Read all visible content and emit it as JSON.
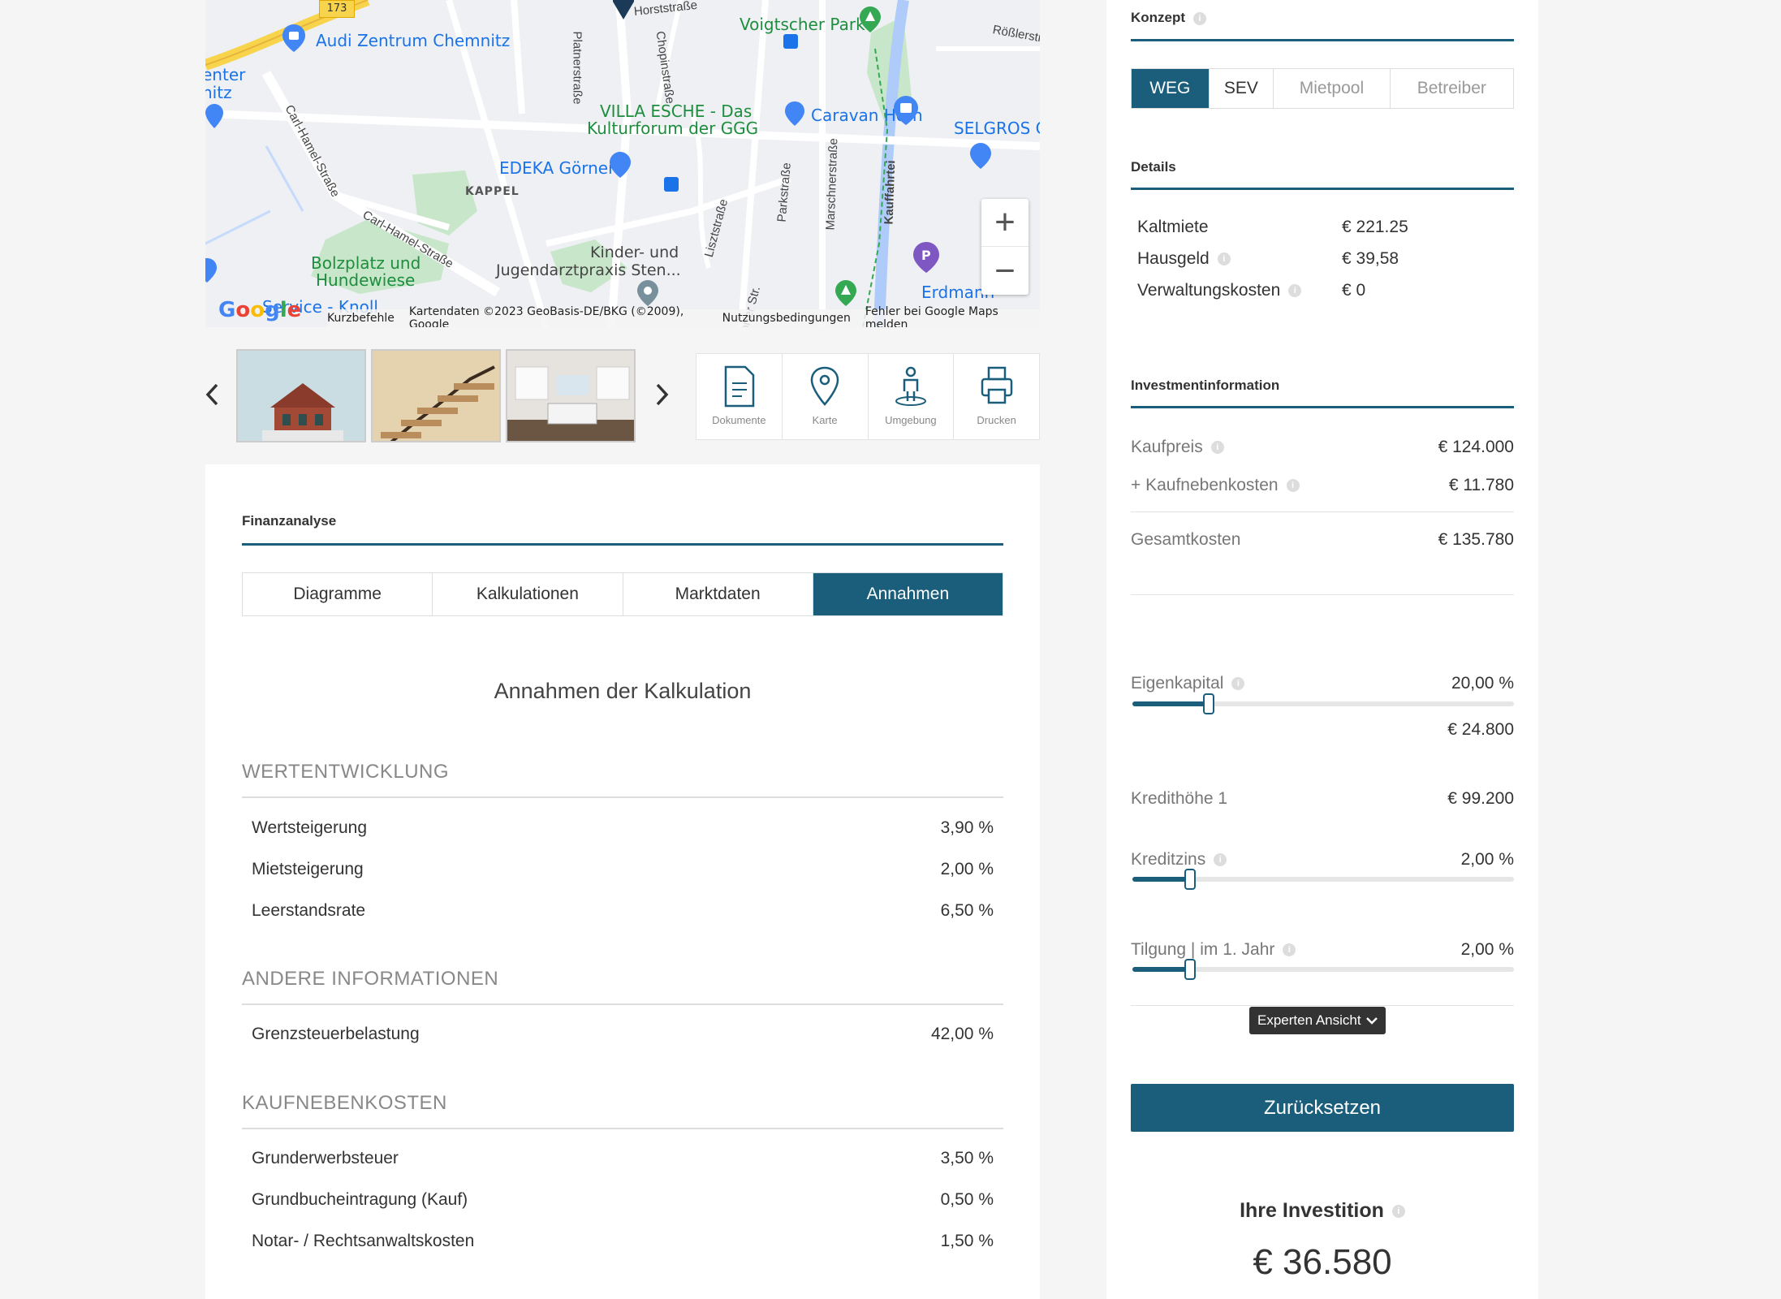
{
  "map": {
    "labels": {
      "audi": "Audi Zentrum Chemnitz",
      "voigtscher": "Voigtscher Park",
      "horststrasse": "Horststraße",
      "rosslerstrasse": "Rößlerstraße",
      "villa": "VILLA ESCHE - Das",
      "kulturforum": "Kulturforum der GGG",
      "caravan": "Caravan Horn",
      "selgros": "SELGROS C",
      "edeka": "EDEKA Görner",
      "kappel": "KAPPEL",
      "bolzplatz1": "Bolzplatz und",
      "bolzplatz2": "Hundewiese",
      "kinder1": "Kinder- und",
      "kinder2": "Jugendarztpraxis Sten...",
      "erdmann": "Erdmann",
      "service": "Service - Knoll",
      "center": "enter",
      "nitz": "nitz",
      "road173": "173",
      "carlhamel1": "Carl-Hamel-Straße",
      "carlhamel2": "Carl-Hamel-Straße",
      "platnerstrasse": "Platnerstraße",
      "chopinstrasse": "Chopinstraße",
      "lisztstrasse": "Lisztstraße",
      "parkstrasse": "Parkstraße",
      "marschnerstrasse": "Marschnerstraße",
      "kauffahrtei": "Kauffahrtei",
      "dorferstr": "orfer Str."
    },
    "zoom_in": "+",
    "zoom_out": "−",
    "footer": {
      "shortcuts": "Kurzbefehle",
      "mapdata": "Kartendaten ©2023 GeoBasis-DE/BKG (©2009), Google",
      "terms": "Nutzungsbedingungen",
      "report": "Fehler bei Google Maps melden"
    },
    "logo": "Google"
  },
  "gallery": {
    "prev": "‹",
    "next": "›",
    "tools": [
      {
        "label": "Dokumente",
        "icon": "document-icon"
      },
      {
        "label": "Karte",
        "icon": "map-pin-icon"
      },
      {
        "label": "Umgebung",
        "icon": "person-location-icon"
      },
      {
        "label": "Drucken",
        "icon": "printer-icon"
      }
    ]
  },
  "finanz": {
    "title": "Finanzanalyse",
    "tabs": [
      "Diagramme",
      "Kalkulationen",
      "Marktdaten",
      "Annahmen"
    ],
    "active_tab": "Annahmen",
    "heading": "Annahmen der Kalkulation",
    "groups": [
      {
        "title": "WERTENTWICKLUNG",
        "rows": [
          {
            "label": "Wertsteigerung",
            "value": "3,90 %"
          },
          {
            "label": "Mietsteigerung",
            "value": "2,00 %"
          },
          {
            "label": "Leerstandsrate",
            "value": "6,50 %"
          }
        ]
      },
      {
        "title": "ANDERE INFORMATIONEN",
        "rows": [
          {
            "label": "Grenzsteuerbelastung",
            "value": "42,00 %"
          }
        ]
      },
      {
        "title": "KAUFNEBENKOSTEN",
        "rows": [
          {
            "label": "Grunderwerbsteuer",
            "value": "3,50 %"
          },
          {
            "label": "Grundbucheintragung (Kauf)",
            "value": "0,50 %"
          },
          {
            "label": "Notar- / Rechtsanwaltskosten",
            "value": "1,50 %"
          }
        ]
      }
    ]
  },
  "sidebar": {
    "konzept_title": "Konzept",
    "konzept_options": [
      "WEG",
      "SEV",
      "Mietpool",
      "Betreiber"
    ],
    "konzept_active": "WEG",
    "details_title": "Details",
    "details": [
      {
        "label": "Kaltmiete",
        "value": "€ 221.25",
        "info": false
      },
      {
        "label": "Hausgeld",
        "value": "€ 39,58",
        "info": true
      },
      {
        "label": "Verwaltungskosten",
        "value": "€ 0",
        "info": true
      }
    ],
    "invest_title": "Investmentinformation",
    "kaufpreis": {
      "label": "Kaufpreis",
      "value": "€ 124.000"
    },
    "kaufnebenkosten": {
      "label": "+ Kaufnebenkosten",
      "value": "€ 11.780"
    },
    "gesamtkosten": {
      "label": "Gesamtkosten",
      "value": "€ 135.780"
    },
    "eigenkapital": {
      "label": "Eigenkapital",
      "value": "20,00 %",
      "amount": "€ 24.800",
      "level": 0.2
    },
    "kredithoehe": {
      "label": "Kredithöhe 1",
      "value": "€ 99.200"
    },
    "kreditzins": {
      "label": "Kreditzins",
      "value": "2,00 %",
      "level": 0.15
    },
    "tilgung": {
      "label": "Tilgung | im 1. Jahr",
      "value": "2,00 %",
      "level": 0.15
    },
    "expert_label": "Experten Ansicht",
    "reset_label": "Zurücksetzen",
    "ihre_label": "Ihre Investition",
    "ihre_value": "€ 36.580"
  },
  "colors": {
    "accent": "#1b5e7b",
    "map_bg": "#eef0f3",
    "park": "#c3e6cb",
    "road_yellow": "#f7d44c",
    "poi_blue": "#1a73e8",
    "poi_green": "#1e8e3e"
  }
}
